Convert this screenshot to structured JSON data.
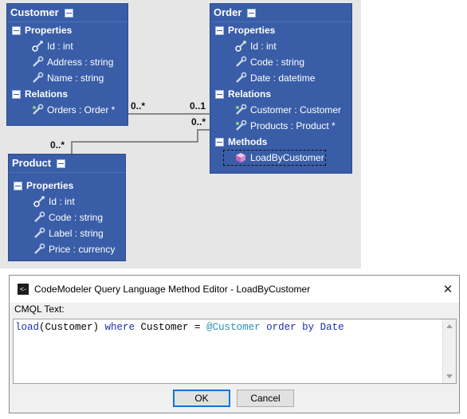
{
  "diagram": {
    "entities": {
      "customer": {
        "title": "Customer",
        "sections": {
          "properties": {
            "label": "Properties",
            "items": [
              "Id : int",
              "Address : string",
              "Name : string"
            ]
          },
          "relations": {
            "label": "Relations",
            "items": [
              "Orders : Order *"
            ]
          }
        }
      },
      "order": {
        "title": "Order",
        "sections": {
          "properties": {
            "label": "Properties",
            "items": [
              "Id : int",
              "Code : string",
              "Date : datetime"
            ]
          },
          "relations": {
            "label": "Relations",
            "items": [
              "Customer : Customer",
              "Products : Product *"
            ]
          },
          "methods": {
            "label": "Methods",
            "items": [
              "LoadByCustomer"
            ]
          }
        }
      },
      "product": {
        "title": "Product",
        "sections": {
          "properties": {
            "label": "Properties",
            "items": [
              "Id : int",
              "Code : string",
              "Label : string",
              "Price : currency"
            ]
          }
        }
      }
    },
    "multiplicities": {
      "customer_orders_near": "0..*",
      "customer_orders_far": "0..1",
      "order_products_near": "0..*",
      "product_end": "0..*"
    }
  },
  "dialog": {
    "title": "CodeModeler Query Language Method Editor - LoadByCustomer",
    "icon_glyph": "<-",
    "close_glyph": "✕",
    "field_label": "CMQL Text:",
    "code": {
      "t1": "load",
      "t2": "(Customer) ",
      "t3": "where",
      "t4": " Customer = ",
      "t5": "@Customer",
      "t6": " ",
      "t7": "order by",
      "t8": " Date"
    },
    "ok_label": "OK",
    "cancel_label": "Cancel"
  },
  "colors": {
    "entity_bg": "#3a5da8",
    "canvas_bg": "#e6e6e6",
    "keyword": "#1a2fb0",
    "parameter": "#2b8fb3"
  },
  "icons": {
    "property": "wrench-key-icon",
    "relation": "relation-wrench-icon",
    "method": "cube-method-icon",
    "section_toggle": "collapse-minus-icon"
  }
}
